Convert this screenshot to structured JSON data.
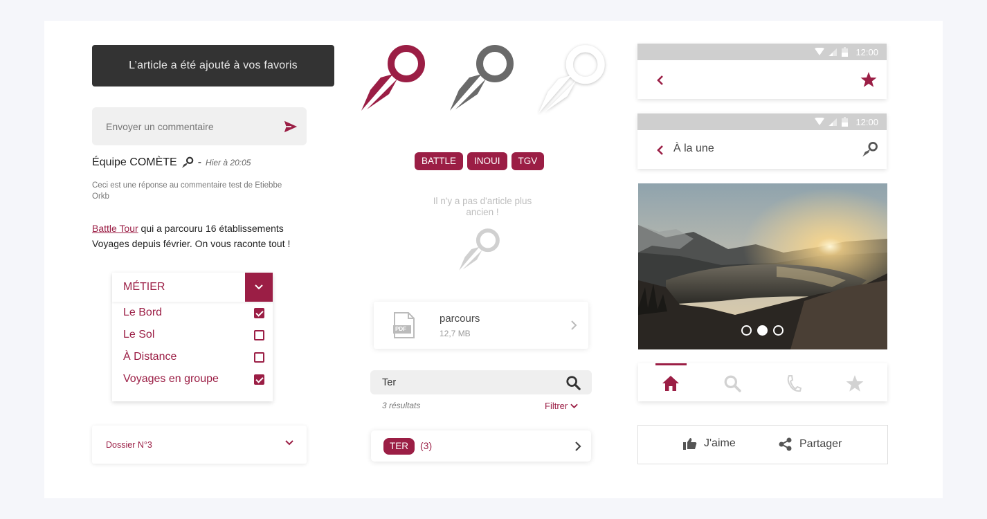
{
  "colors": {
    "accent": "#9b1e45",
    "toast_bg": "#333333",
    "statusbar": "#cfcfcf"
  },
  "toast": {
    "text": "L’article a été ajouté à vos favoris"
  },
  "comment_input": {
    "placeholder": "Envoyer un commentaire",
    "icon": "send-icon"
  },
  "comment": {
    "author": "Équipe COMÈTE",
    "separator": "-",
    "date": "Hier à 20:05",
    "reply": "Ceci est une réponse au commentaire test de Etiebbe Orkb"
  },
  "news": {
    "link": "Battle Tour",
    "text": " qui a parcouru 16 établissements Voyages depuis février. On vous raconte tout !"
  },
  "metier": {
    "title": "MÉTIER",
    "items": [
      {
        "label": "Le Bord",
        "checked": true
      },
      {
        "label": "Le Sol",
        "checked": false
      },
      {
        "label": "À Distance",
        "checked": false
      },
      {
        "label": "Voyages en groupe",
        "checked": true
      }
    ]
  },
  "dossier": {
    "label": "Dossier N°3"
  },
  "tags": [
    "BATTLE",
    "INOUI",
    "TGV"
  ],
  "empty_state": {
    "text": "Il n'y a pas d'article plus ancien !"
  },
  "file": {
    "name": "parcours",
    "size": "12,7 MB",
    "badge": "PDF"
  },
  "search": {
    "value": "Ter",
    "results": "3 résultats",
    "filter": "Filtrer"
  },
  "ter_result": {
    "label": "TER",
    "count": "(3)"
  },
  "appbar1": {
    "time": "12:00"
  },
  "appbar2": {
    "time": "12:00",
    "title": "À la une"
  },
  "carousel": {
    "slides": 3,
    "active": 2
  },
  "tabbar": {
    "tabs": [
      "home-icon",
      "search-icon",
      "phone-icon",
      "star-icon"
    ],
    "active": 0
  },
  "social": {
    "like": "J'aime",
    "share": "Partager"
  }
}
